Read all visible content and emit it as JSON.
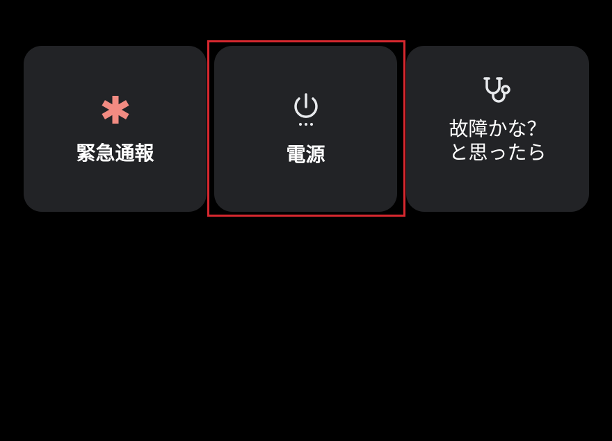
{
  "tiles": [
    {
      "label": "緊急通報",
      "icon": "asterisk-icon",
      "icon_color": "#f28b82"
    },
    {
      "label": "電源",
      "icon": "power-icon",
      "icon_color": "#e8eaed"
    },
    {
      "label_lines": [
        "故障かな？",
        "と思ったら"
      ],
      "icon": "stethoscope-icon",
      "icon_color": "#e8eaed"
    }
  ],
  "colors": {
    "background": "#000000",
    "tile": "#222326",
    "highlight": "#d7282f"
  }
}
